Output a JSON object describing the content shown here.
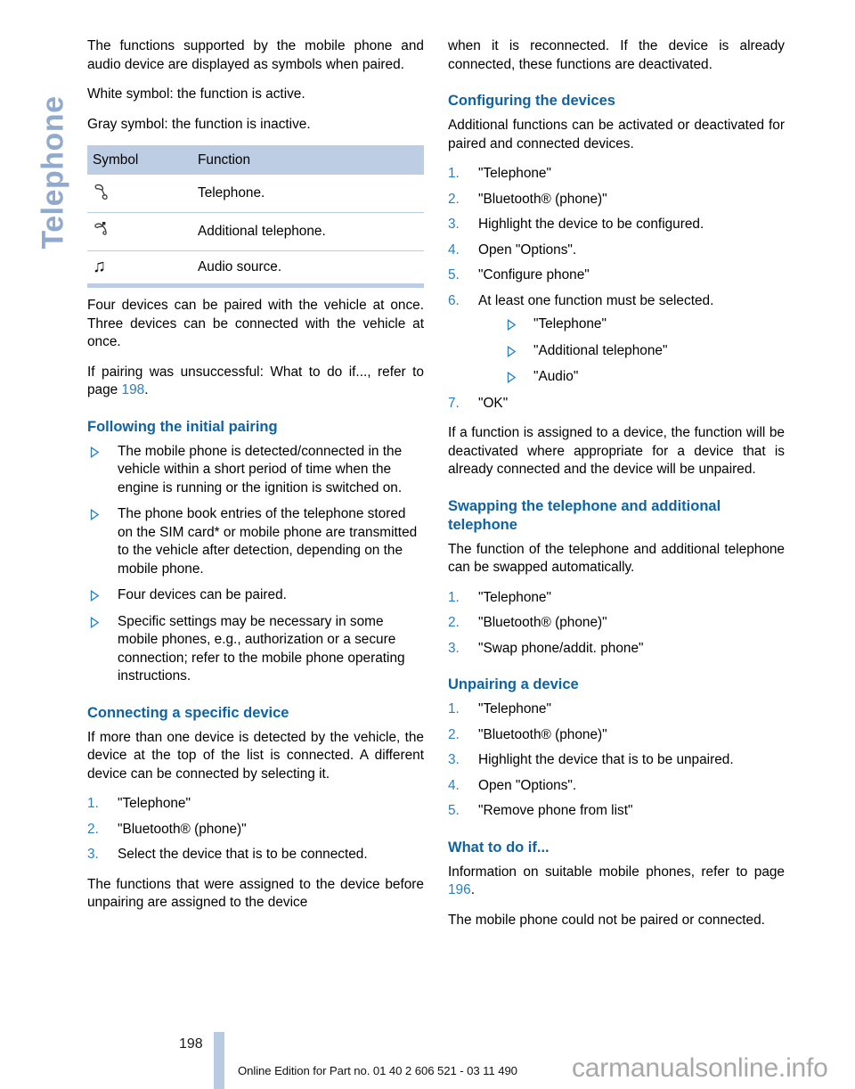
{
  "sidebar": {
    "chapter_label": "Telephone",
    "color": "#90aacf"
  },
  "theme": {
    "heading_blue": "#0e62a5",
    "list_number_blue": "#2a7fc0",
    "table_header_bg": "#bccde4",
    "rule_blue": "#b9cbe2"
  },
  "left_column": {
    "intro_paragraph": "The functions supported by the mobile phone and audio device are displayed as symbols when paired.",
    "white_symbol_note": "White symbol: the function is active.",
    "gray_symbol_note": "Gray symbol: the function is inactive.",
    "symbol_table": {
      "headers": [
        "Symbol",
        "Function"
      ],
      "rows": [
        {
          "symbol_icon": "telephone-handset-icon",
          "function": "Telephone."
        },
        {
          "symbol_icon": "additional-telephone-icon",
          "function": "Additional telephone."
        },
        {
          "symbol_icon": "music-note-icon",
          "function": "Audio source."
        }
      ]
    },
    "pairing_paragraph": "Four devices can be paired with the vehicle at once. Three devices can be connected with the vehicle at once.",
    "unsuccessful_prefix": "If pairing was unsuccessful: What to do if..., refer to page ",
    "unsuccessful_pageref": "198",
    "unsuccessful_suffix": ".",
    "following_heading": "Following the initial pairing",
    "following_bullets": [
      "The mobile phone is detected/connected in the vehicle within a short period of time when the engine is running or the ignition is switched on.",
      "The phone book entries of the telephone stored on the SIM card* or mobile phone are transmitted to the vehicle after detection, depending on the mobile phone.",
      "Four devices can be paired.",
      "Specific settings may be necessary in some mobile phones, e.g., authorization or a secure connection; refer to the mobile phone operating instructions."
    ],
    "connecting_heading": "Connecting a specific device",
    "connecting_paragraph": "If more than one device is detected by the vehicle, the device at the top of the list is connected. A different device can be connected by selecting it.",
    "connecting_steps": [
      {
        "num": "1.",
        "text": "\"Telephone\""
      },
      {
        "num": "2.",
        "text": "\"Bluetooth® (phone)\""
      },
      {
        "num": "3.",
        "text": "Select the device that is to be connected."
      }
    ],
    "connecting_tail": "The functions that were assigned to the device before unpairing are assigned to the device"
  },
  "right_column": {
    "continuation_paragraph": "when it is reconnected. If the device is already connected, these functions are deactivated.",
    "configuring_heading": "Configuring the devices",
    "configuring_paragraph": "Additional functions can be activated or deactivated for paired and connected devices.",
    "configuring_steps": [
      {
        "num": "1.",
        "text": "\"Telephone\""
      },
      {
        "num": "2.",
        "text": "\"Bluetooth® (phone)\""
      },
      {
        "num": "3.",
        "text": "Highlight the device to be configured."
      },
      {
        "num": "4.",
        "text": "Open \"Options\"."
      },
      {
        "num": "5.",
        "text": "\"Configure phone\""
      },
      {
        "num": "6.",
        "text": "At least one function must be selected."
      },
      {
        "num": "7.",
        "text": "\"OK\""
      }
    ],
    "configuring_substeps": [
      "\"Telephone\"",
      "\"Additional telephone\"",
      "\"Audio\""
    ],
    "assigned_paragraph": "If a function is assigned to a device, the function will be deactivated where appropriate for a device that is already connected and the device will be unpaired.",
    "swapping_heading": "Swapping the telephone and additional telephone",
    "swapping_paragraph": "The function of the telephone and additional telephone can be swapped automatically.",
    "swapping_steps": [
      {
        "num": "1.",
        "text": "\"Telephone\""
      },
      {
        "num": "2.",
        "text": "\"Bluetooth® (phone)\""
      },
      {
        "num": "3.",
        "text": "\"Swap phone/addit. phone\""
      }
    ],
    "unpairing_heading": "Unpairing a device",
    "unpairing_steps": [
      {
        "num": "1.",
        "text": "\"Telephone\""
      },
      {
        "num": "2.",
        "text": "\"Bluetooth® (phone)\""
      },
      {
        "num": "3.",
        "text": "Highlight the device that is to be unpaired."
      },
      {
        "num": "4.",
        "text": "Open \"Options\"."
      },
      {
        "num": "5.",
        "text": "\"Remove phone from list\""
      }
    ],
    "what_to_do_heading": "What to do if...",
    "what_to_do_prefix": "Information on suitable mobile phones, refer to page ",
    "what_to_do_pageref": "196",
    "what_to_do_suffix": ".",
    "what_to_do_tail": "The mobile phone could not be paired or connected."
  },
  "footer": {
    "page_number": "198",
    "edition_text": "Online Edition for Part no. 01 40 2 606 521 - 03 11 490",
    "watermark": "carmanualsonline.info"
  }
}
